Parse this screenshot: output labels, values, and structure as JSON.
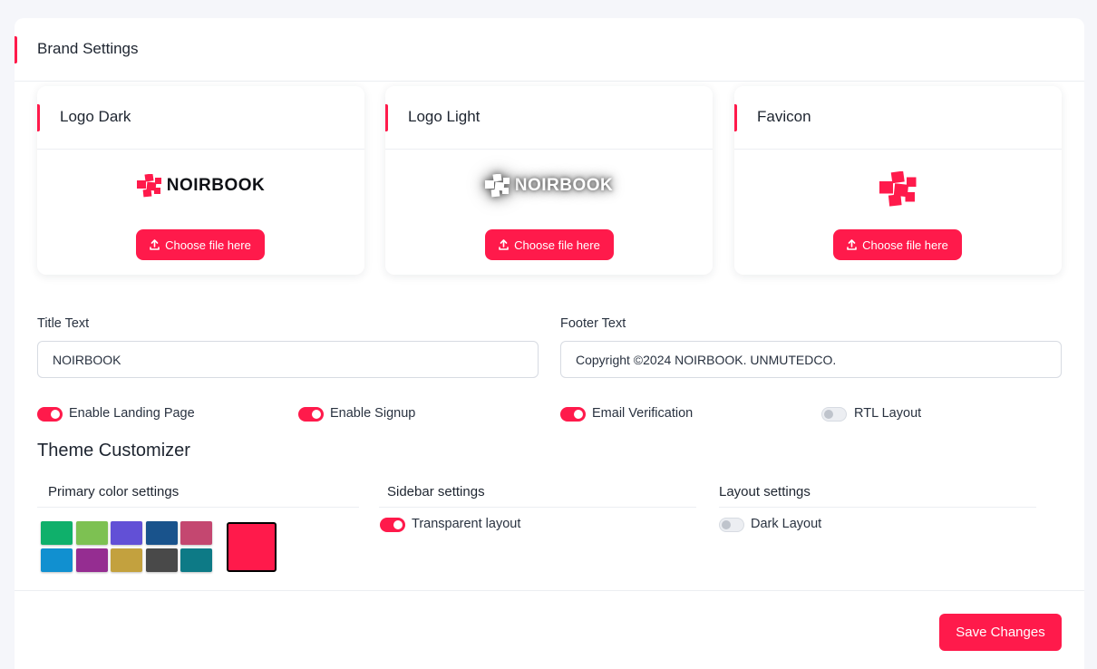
{
  "card": {
    "title": "Brand Settings"
  },
  "logos": [
    {
      "title": "Logo Dark",
      "wordmark": "NOIRBOOK",
      "button": "Choose file here"
    },
    {
      "title": "Logo Light",
      "wordmark": "NOIRBOOK",
      "button": "Choose file here"
    },
    {
      "title": "Favicon",
      "button": "Choose file here"
    }
  ],
  "title_text": {
    "label": "Title Text",
    "value": "NOIRBOOK"
  },
  "footer_text": {
    "label": "Footer Text",
    "value": "Copyright ©2024 NOIRBOOK. UNMUTEDCO."
  },
  "toggles": [
    {
      "label": "Enable Landing Page",
      "on": true
    },
    {
      "label": "Enable Signup",
      "on": true
    },
    {
      "label": "Email Verification",
      "on": true
    },
    {
      "label": "RTL Layout",
      "on": false
    }
  ],
  "theme": {
    "title": "Theme Customizer",
    "primary_color": {
      "title": "Primary color settings",
      "swatches": [
        "#0fb06b",
        "#7dc152",
        "#6250d6",
        "#19538c",
        "#c44770",
        "#1190d0",
        "#952d91",
        "#c3a13e",
        "#494949",
        "#0d7a86"
      ],
      "selected": "#ff1a4b"
    },
    "sidebar": {
      "title": "Sidebar settings",
      "toggle_label": "Transparent layout",
      "on": true
    },
    "layout": {
      "title": "Layout settings",
      "toggle_label": "Dark Layout",
      "on": false
    }
  },
  "save_label": "Save Changes",
  "accent_color": "#ff1a4b"
}
